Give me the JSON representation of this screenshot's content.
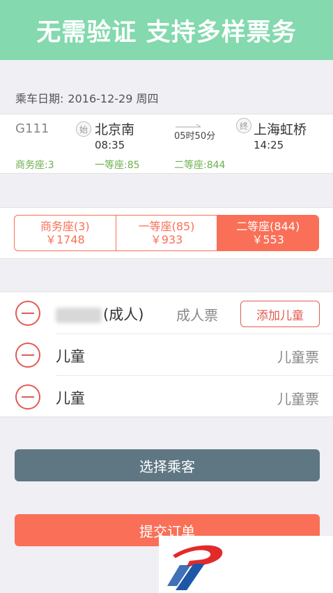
{
  "banner": {
    "text": "无需验证 支持多样票务"
  },
  "trip": {
    "date_label": "乘车日期:",
    "date": "2016-12-29 周四",
    "train_no": "G111",
    "from": {
      "badge": "始",
      "station": "北京南",
      "time": "08:35"
    },
    "to": {
      "badge": "终",
      "station": "上海虹桥",
      "time": "14:25"
    },
    "duration": "05时50分",
    "availability": [
      {
        "label": "商务座:3"
      },
      {
        "label": "一等座:85"
      },
      {
        "label": "二等座:844"
      }
    ]
  },
  "seat_options": [
    {
      "name": "商务座(3)",
      "price": "￥1748",
      "selected": false
    },
    {
      "name": "一等座(85)",
      "price": "￥933",
      "selected": false
    },
    {
      "name": "二等座(844)",
      "price": "￥553",
      "selected": true
    }
  ],
  "passengers": [
    {
      "name": "(成人)",
      "type": "成人票",
      "action": "添加儿童"
    },
    {
      "name": "儿童",
      "type": "儿童票"
    },
    {
      "name": "儿童",
      "type": "儿童票"
    }
  ],
  "buttons": {
    "select_passenger": "选择乘客",
    "submit_order": "提交订单"
  },
  "colors": {
    "banner": "#84d9ae",
    "accent": "#fa6f57",
    "minus": "#e25b52",
    "select_button": "#5f7683",
    "availability": "#6ab04c"
  },
  "icons": {
    "minus": "minus-circle-icon",
    "arrow": "arrow-right-icon",
    "logo": "brand-logo-icon"
  }
}
